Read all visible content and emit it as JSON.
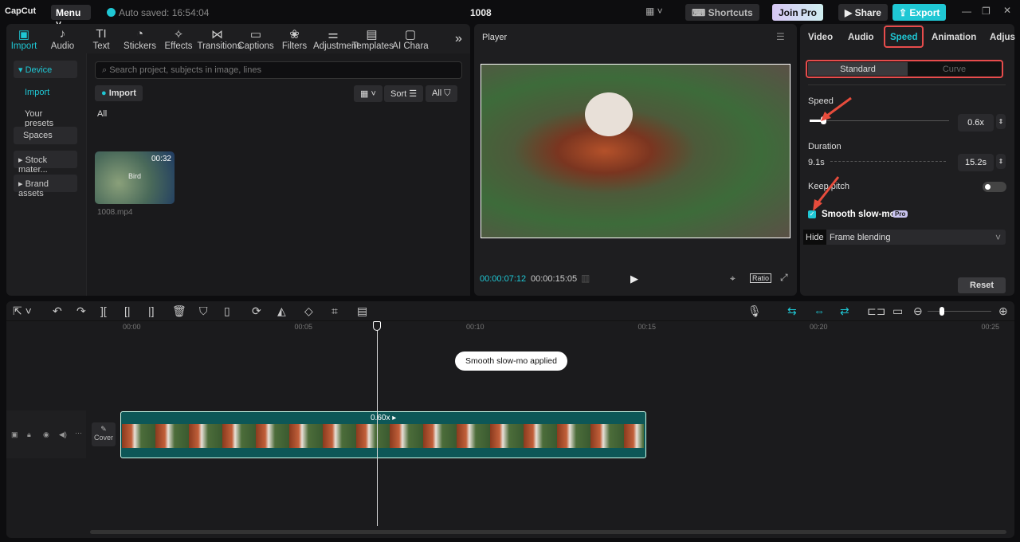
{
  "app": {
    "logo": "CapCut",
    "menu": "Menu",
    "autosave": "Auto saved: 16:54:04",
    "title": "1008",
    "shortcuts": "Shortcuts",
    "join_pro": "Join Pro",
    "share": "Share",
    "export": "Export"
  },
  "media_tabs": [
    {
      "label": "Import",
      "icon": "▣"
    },
    {
      "label": "Audio",
      "icon": "♪"
    },
    {
      "label": "Text",
      "icon": "TI"
    },
    {
      "label": "Stickers",
      "icon": "◔"
    },
    {
      "label": "Effects",
      "icon": "✧"
    },
    {
      "label": "Transitions",
      "icon": "⋈"
    },
    {
      "label": "Captions",
      "icon": "▭"
    },
    {
      "label": "Filters",
      "icon": "❀"
    },
    {
      "label": "Adjustment",
      "icon": "⚌"
    },
    {
      "label": "Templates",
      "icon": "▤"
    },
    {
      "label": "AI Chara",
      "icon": "▢"
    }
  ],
  "sidebar": {
    "device": "▾ Device",
    "import": "Import",
    "presets": "Your presets",
    "spaces": "Spaces",
    "stock": "▸ Stock mater...",
    "brand": "▸ Brand assets"
  },
  "media": {
    "search_placeholder": "Search project, subjects in image, lines",
    "import": "Import",
    "sort": "Sort",
    "all_filter": "All",
    "section": "All",
    "clip_duration": "00:32",
    "clip_overlay": "Bird",
    "clip_name": "1008.mp4"
  },
  "player": {
    "title": "Player",
    "current": "00:00:07:12",
    "total": "00:00:15:05",
    "ratio": "Ratio"
  },
  "right": {
    "tabs": [
      "Video",
      "Audio",
      "Speed",
      "Animation",
      "Adjus"
    ],
    "standard": "Standard",
    "curve": "Curve",
    "speed_label": "Speed",
    "speed_value": "0.6x",
    "speed_fraction": 0.06,
    "duration_label": "Duration",
    "duration_from": "9.1s",
    "duration_value": "15.2s",
    "keep_pitch": "Keep pitch",
    "smooth": "Smooth slow-mo",
    "pro": "Pro",
    "hide": "Hide",
    "blending": "Frame blending",
    "reset": "Reset"
  },
  "timeline": {
    "ticks": [
      "00:00",
      "00:05",
      "00:10",
      "00:15",
      "00:20",
      "00:25"
    ],
    "toast": "Smooth slow-mo applied",
    "clip_speed": "0.60x",
    "cover": "Cover"
  },
  "colors": {
    "accent": "#1fc7d4",
    "clip": "#0d5757"
  }
}
